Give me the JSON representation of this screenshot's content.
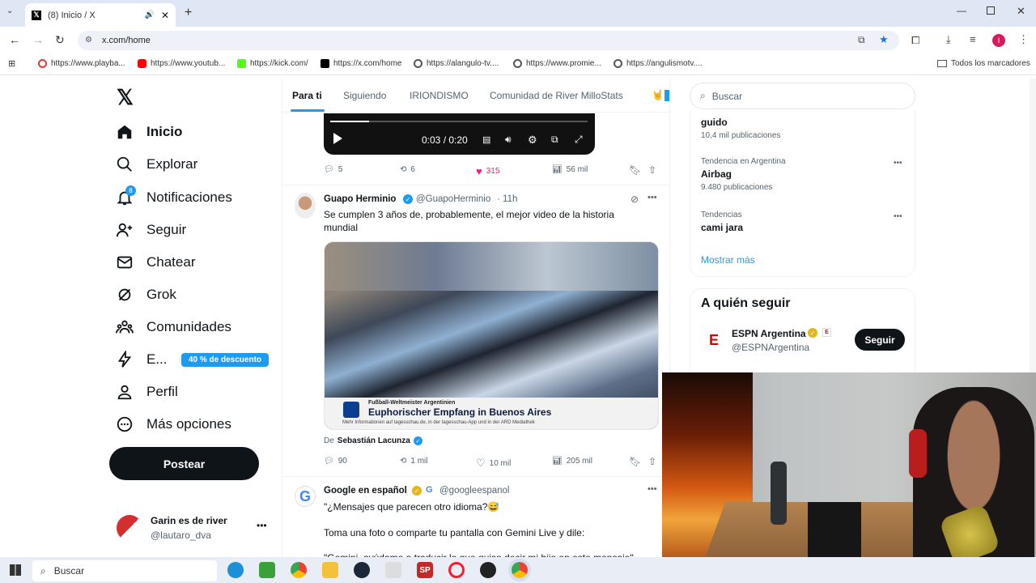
{
  "browser": {
    "tab_title": "(8) Inicio / X",
    "url": "x.com/home",
    "bookmarks": [
      "https://www.playba...",
      "https://www.youtub...",
      "https://kick.com/",
      "https://x.com/home",
      "https://alangulo-tv....",
      "https://www.promie...",
      "https://angulismotv...."
    ],
    "all_bookmarks": "Todos los marcadores",
    "profile_initial": "I"
  },
  "sidebar": {
    "items": [
      {
        "label": "Inicio",
        "icon": "home-icon"
      },
      {
        "label": "Explorar",
        "icon": "search-icon"
      },
      {
        "label": "Notificaciones",
        "icon": "bell-icon",
        "badge": "8"
      },
      {
        "label": "Seguir",
        "icon": "follow-icon"
      },
      {
        "label": "Chatear",
        "icon": "mail-icon"
      },
      {
        "label": "Grok",
        "icon": "grok-icon"
      },
      {
        "label": "Comunidades",
        "icon": "communities-icon"
      },
      {
        "label": "E...",
        "icon": "premium-icon",
        "promo": "40 % de descuento"
      },
      {
        "label": "Perfil",
        "icon": "profile-icon"
      },
      {
        "label": "Más opciones",
        "icon": "more-icon"
      }
    ],
    "post_button": "Postear",
    "account": {
      "name": "Garin es de river",
      "handle": "@lautaro_dva"
    }
  },
  "feed": {
    "tabs": [
      "Para ti",
      "Siguiendo",
      "IRIONDISMO",
      "Comunidad de River MilloStats"
    ],
    "video": {
      "time": "0:03 / 0:20",
      "progress": 0.15
    },
    "first_actions": {
      "replies": "5",
      "reposts": "6",
      "likes": "315",
      "views": "56 mil"
    },
    "tweet1": {
      "name": "Guapo Herminio",
      "handle": "@GuapoHerminio",
      "time": "· 11h",
      "text": "Se cumplen 3 años de, probablemente, el mejor video de la historia mundial",
      "caption_small": "Fußball-Weltmeister Argentinien",
      "caption_big": "Euphorischer Empfang in Buenos Aires",
      "caption_footer": "Mehr Informationen auf tagesschau.de, in der tagesschau-App und in der ARD Mediathek",
      "from_prefix": "De",
      "from_name": "Sebastián Lacunza",
      "replies": "90",
      "reposts": "1 mil",
      "likes": "10 mil",
      "views": "205 mil"
    },
    "tweet2": {
      "name": "Google en español",
      "handle": "@googleespanol",
      "line1": "\"¿Mensajes que parecen otro idioma?😅",
      "line2": "Toma una foto o comparte tu pantalla con Gemini Live y dile:",
      "line3": "\"Gemini, ayúdame a traducir lo que quiso decir mi hijo en este mensaje\""
    }
  },
  "right": {
    "search_placeholder": "Buscar",
    "trends": [
      {
        "name": "guido",
        "posts": "10,4 mil publicaciones"
      },
      {
        "context": "Tendencia en Argentina",
        "name": "Airbag",
        "posts": "9.480 publicaciones"
      },
      {
        "context": "Tendencias",
        "name": "cami jara"
      }
    ],
    "show_more": "Mostrar más",
    "who_to_follow": "A quién seguir",
    "suggest": {
      "name": "ESPN Argentina",
      "handle": "@ESPNArgentina",
      "button": "Seguir"
    }
  },
  "taskbar": {
    "search": "Buscar"
  },
  "colors": {
    "like": "#f91880",
    "accent": "#1d9bf0",
    "badge": "#1d9bf0"
  }
}
